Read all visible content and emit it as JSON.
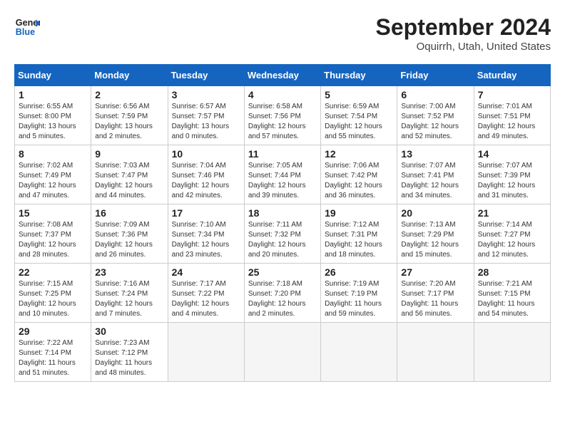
{
  "header": {
    "logo_line1": "General",
    "logo_line2": "Blue",
    "month_title": "September 2024",
    "location": "Oquirrh, Utah, United States"
  },
  "days_of_week": [
    "Sunday",
    "Monday",
    "Tuesday",
    "Wednesday",
    "Thursday",
    "Friday",
    "Saturday"
  ],
  "weeks": [
    [
      {
        "day": 1,
        "sunrise": "6:55 AM",
        "sunset": "8:00 PM",
        "daylight": "13 hours and 5 minutes."
      },
      {
        "day": 2,
        "sunrise": "6:56 AM",
        "sunset": "7:59 PM",
        "daylight": "13 hours and 2 minutes."
      },
      {
        "day": 3,
        "sunrise": "6:57 AM",
        "sunset": "7:57 PM",
        "daylight": "13 hours and 0 minutes."
      },
      {
        "day": 4,
        "sunrise": "6:58 AM",
        "sunset": "7:56 PM",
        "daylight": "12 hours and 57 minutes."
      },
      {
        "day": 5,
        "sunrise": "6:59 AM",
        "sunset": "7:54 PM",
        "daylight": "12 hours and 55 minutes."
      },
      {
        "day": 6,
        "sunrise": "7:00 AM",
        "sunset": "7:52 PM",
        "daylight": "12 hours and 52 minutes."
      },
      {
        "day": 7,
        "sunrise": "7:01 AM",
        "sunset": "7:51 PM",
        "daylight": "12 hours and 49 minutes."
      }
    ],
    [
      {
        "day": 8,
        "sunrise": "7:02 AM",
        "sunset": "7:49 PM",
        "daylight": "12 hours and 47 minutes."
      },
      {
        "day": 9,
        "sunrise": "7:03 AM",
        "sunset": "7:47 PM",
        "daylight": "12 hours and 44 minutes."
      },
      {
        "day": 10,
        "sunrise": "7:04 AM",
        "sunset": "7:46 PM",
        "daylight": "12 hours and 42 minutes."
      },
      {
        "day": 11,
        "sunrise": "7:05 AM",
        "sunset": "7:44 PM",
        "daylight": "12 hours and 39 minutes."
      },
      {
        "day": 12,
        "sunrise": "7:06 AM",
        "sunset": "7:42 PM",
        "daylight": "12 hours and 36 minutes."
      },
      {
        "day": 13,
        "sunrise": "7:07 AM",
        "sunset": "7:41 PM",
        "daylight": "12 hours and 34 minutes."
      },
      {
        "day": 14,
        "sunrise": "7:07 AM",
        "sunset": "7:39 PM",
        "daylight": "12 hours and 31 minutes."
      }
    ],
    [
      {
        "day": 15,
        "sunrise": "7:08 AM",
        "sunset": "7:37 PM",
        "daylight": "12 hours and 28 minutes."
      },
      {
        "day": 16,
        "sunrise": "7:09 AM",
        "sunset": "7:36 PM",
        "daylight": "12 hours and 26 minutes."
      },
      {
        "day": 17,
        "sunrise": "7:10 AM",
        "sunset": "7:34 PM",
        "daylight": "12 hours and 23 minutes."
      },
      {
        "day": 18,
        "sunrise": "7:11 AM",
        "sunset": "7:32 PM",
        "daylight": "12 hours and 20 minutes."
      },
      {
        "day": 19,
        "sunrise": "7:12 AM",
        "sunset": "7:31 PM",
        "daylight": "12 hours and 18 minutes."
      },
      {
        "day": 20,
        "sunrise": "7:13 AM",
        "sunset": "7:29 PM",
        "daylight": "12 hours and 15 minutes."
      },
      {
        "day": 21,
        "sunrise": "7:14 AM",
        "sunset": "7:27 PM",
        "daylight": "12 hours and 12 minutes."
      }
    ],
    [
      {
        "day": 22,
        "sunrise": "7:15 AM",
        "sunset": "7:25 PM",
        "daylight": "12 hours and 10 minutes."
      },
      {
        "day": 23,
        "sunrise": "7:16 AM",
        "sunset": "7:24 PM",
        "daylight": "12 hours and 7 minutes."
      },
      {
        "day": 24,
        "sunrise": "7:17 AM",
        "sunset": "7:22 PM",
        "daylight": "12 hours and 4 minutes."
      },
      {
        "day": 25,
        "sunrise": "7:18 AM",
        "sunset": "7:20 PM",
        "daylight": "12 hours and 2 minutes."
      },
      {
        "day": 26,
        "sunrise": "7:19 AM",
        "sunset": "7:19 PM",
        "daylight": "11 hours and 59 minutes."
      },
      {
        "day": 27,
        "sunrise": "7:20 AM",
        "sunset": "7:17 PM",
        "daylight": "11 hours and 56 minutes."
      },
      {
        "day": 28,
        "sunrise": "7:21 AM",
        "sunset": "7:15 PM",
        "daylight": "11 hours and 54 minutes."
      }
    ],
    [
      {
        "day": 29,
        "sunrise": "7:22 AM",
        "sunset": "7:14 PM",
        "daylight": "11 hours and 51 minutes."
      },
      {
        "day": 30,
        "sunrise": "7:23 AM",
        "sunset": "7:12 PM",
        "daylight": "11 hours and 48 minutes."
      },
      null,
      null,
      null,
      null,
      null
    ]
  ]
}
